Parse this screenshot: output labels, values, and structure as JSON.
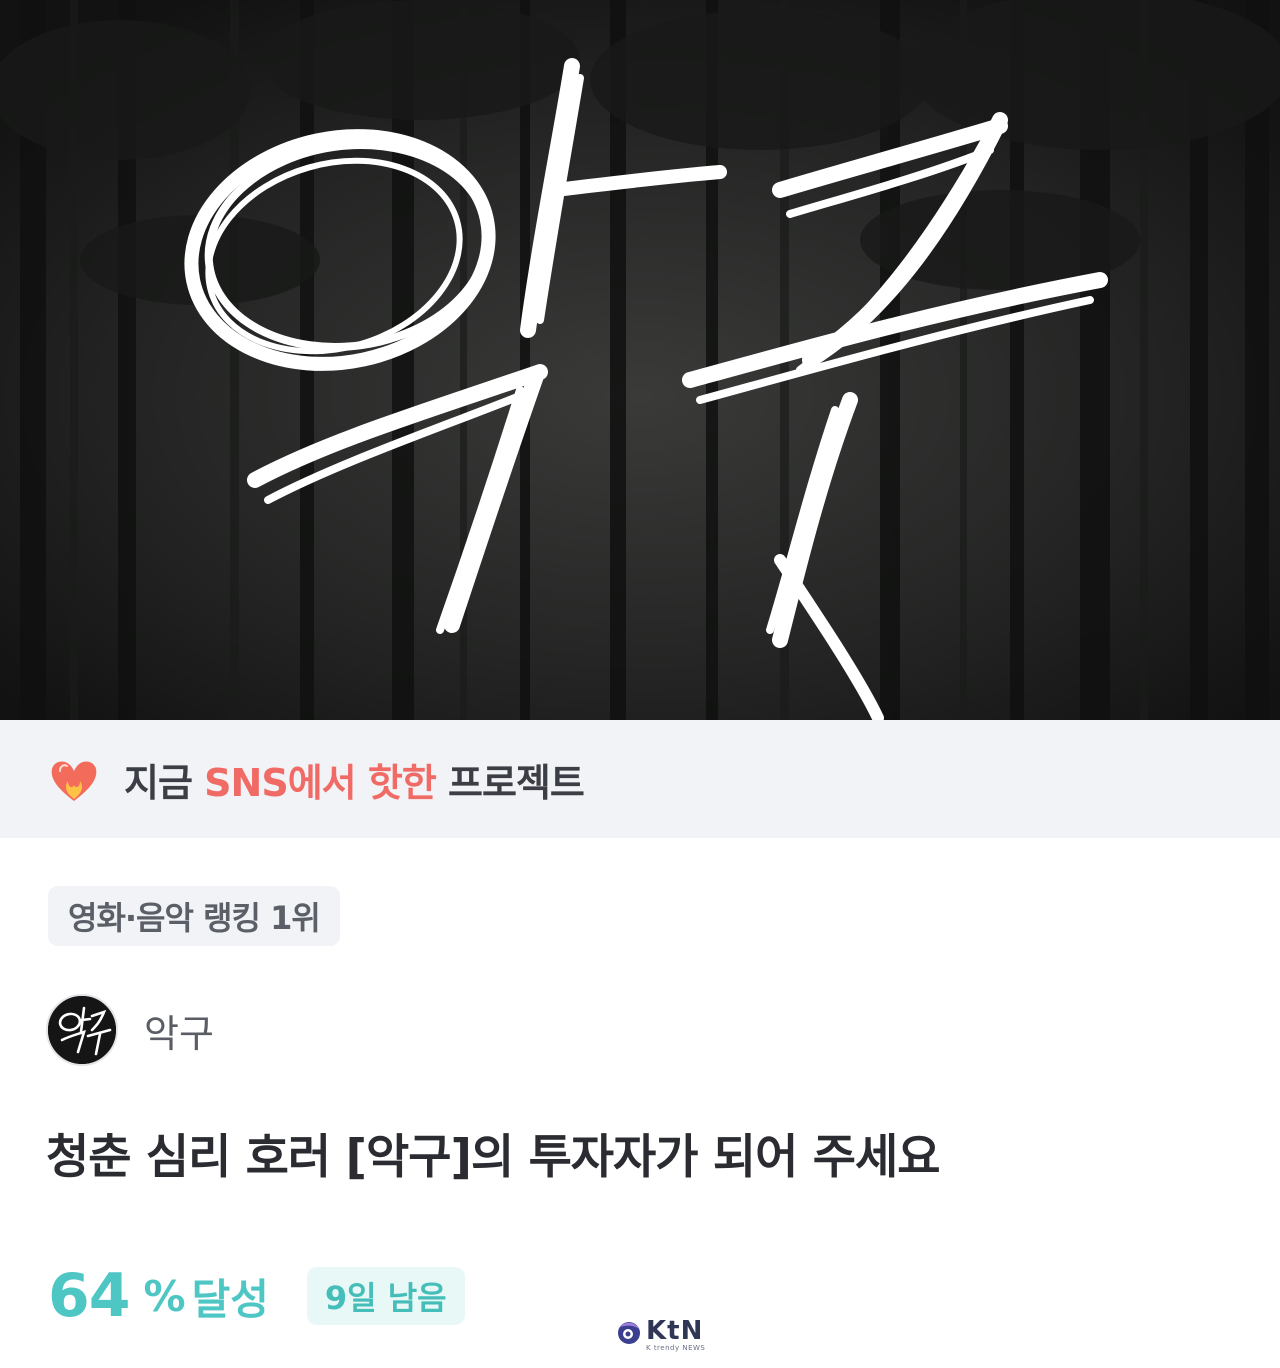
{
  "hero": {
    "logo_text": "악구"
  },
  "hot_banner": {
    "icon": "heart-on-fire-icon",
    "prefix": "지금 ",
    "accent_1": "SNS",
    "middle": "에서 ",
    "accent_2": "핫한",
    "suffix": " 프로젝트",
    "accent_color": "#f06a66"
  },
  "ranking_badge": {
    "label": "영화·음악 랭킹 1위"
  },
  "creator": {
    "avatar_text": "악구",
    "name": "악구"
  },
  "project": {
    "title": "청춘 심리 호러 [악구]의 투자자가 되어 주세요"
  },
  "progress": {
    "percent": "64",
    "unit": "%",
    "label": "달성",
    "days_left": "9일 남음",
    "accent_color": "#4ec7c4"
  },
  "watermark": {
    "brand": "KtN",
    "tagline": "K trendy NEWS"
  }
}
